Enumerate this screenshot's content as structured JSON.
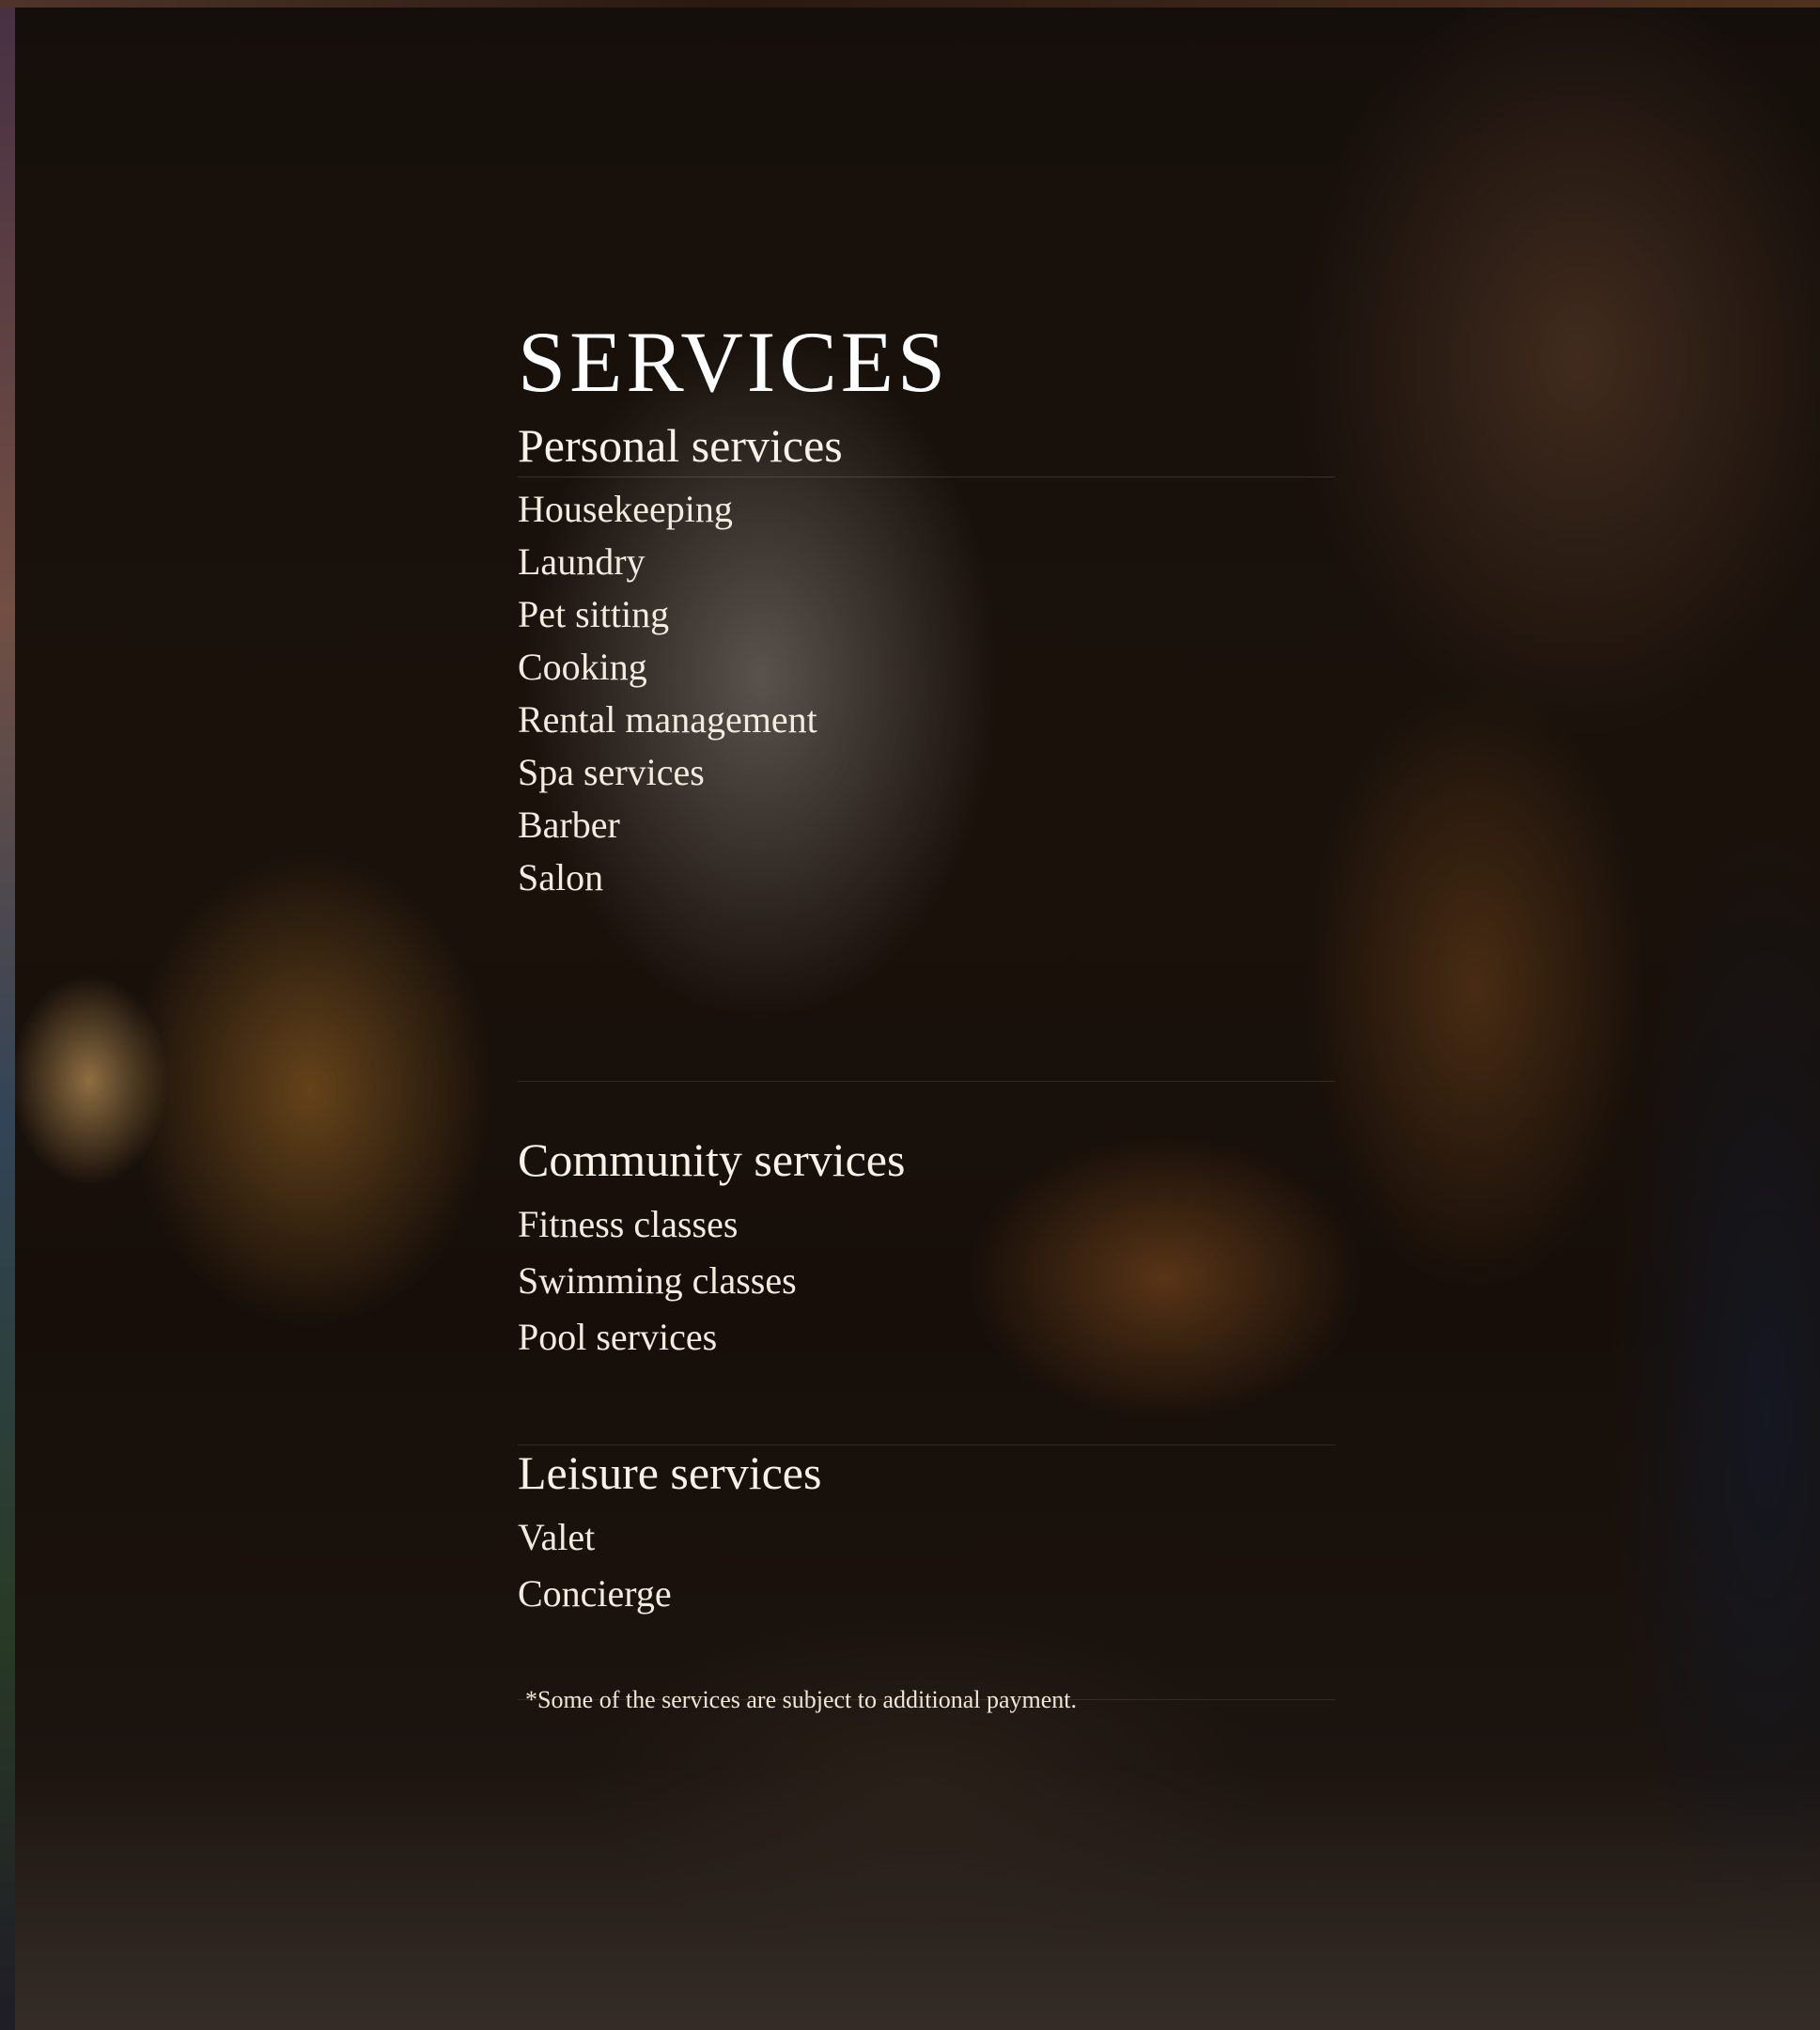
{
  "title": "SERVICES",
  "personal": {
    "heading": "Personal services",
    "items": [
      "Housekeeping",
      "Laundry",
      "Pet sitting",
      "Cooking",
      "Rental management",
      "Spa services",
      "Barber",
      "Salon"
    ]
  },
  "community": {
    "heading": "Community services",
    "items": [
      "Fitness classes",
      "Swimming classes",
      "Pool services"
    ]
  },
  "leisure": {
    "heading": "Leisure services",
    "items": [
      "Valet",
      "Concierge"
    ]
  },
  "footnote": "*Some of the services are subject to additional payment."
}
